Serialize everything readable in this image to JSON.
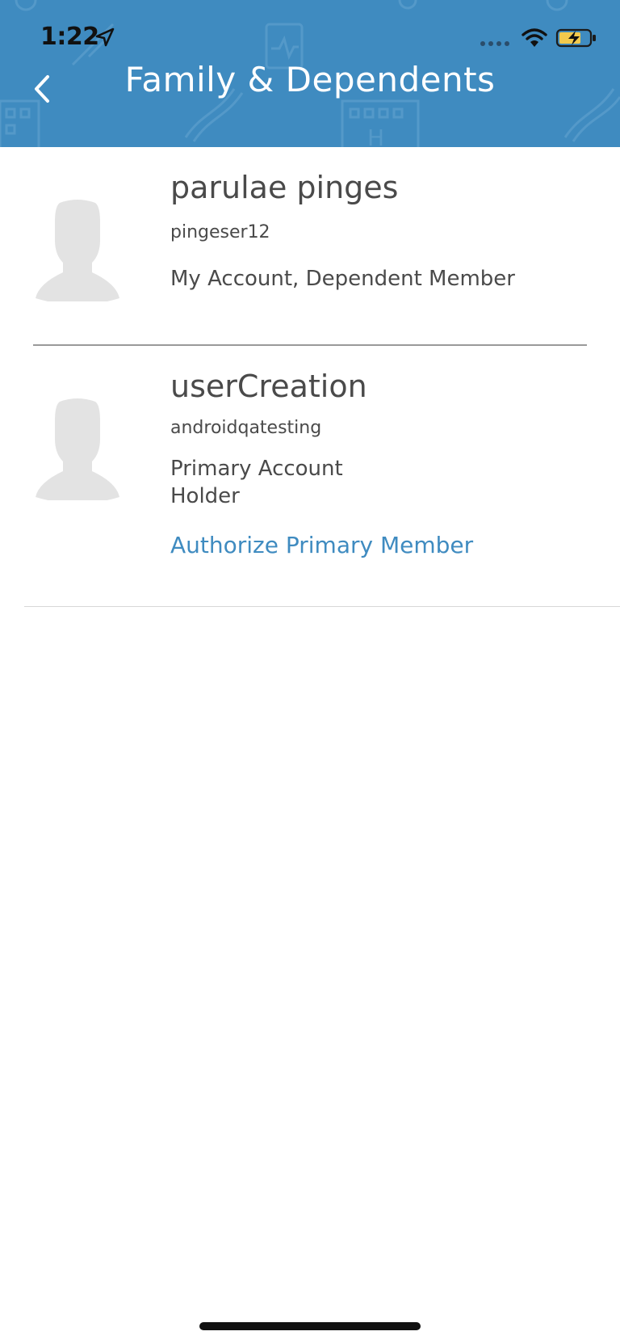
{
  "status_bar": {
    "time": "1:22"
  },
  "header": {
    "title": "Family & Dependents",
    "back_icon": "chevron-left-icon",
    "background_color": "#3f8bc0"
  },
  "members": [
    {
      "name": "parulae pinges",
      "username": "pingeser12",
      "role_lines": [
        "My Account, Dependent Member"
      ]
    },
    {
      "name": "userCreation",
      "username": "androidqatesting",
      "role_lines": [
        "Primary Account",
        "Holder"
      ],
      "action_label": "Authorize Primary Member"
    }
  ],
  "colors": {
    "accent": "#3f8bc0",
    "text": "#4a4a4a",
    "avatar_placeholder": "#e3e3e3"
  }
}
